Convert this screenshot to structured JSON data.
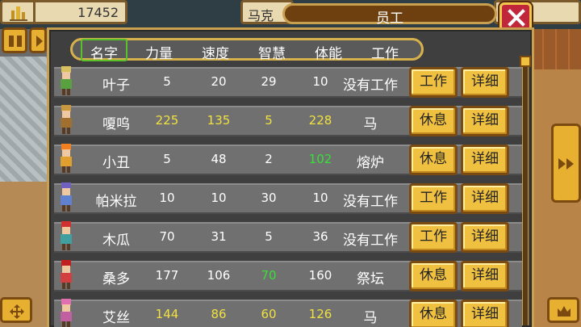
{
  "top": {
    "gold_value": "17452",
    "player_name": "马克",
    "window_title": "员工"
  },
  "columns": [
    "名字",
    "力量",
    "速度",
    "智慧",
    "体能",
    "工作"
  ],
  "rows": [
    {
      "name": "叶子",
      "str": "5",
      "spd": "20",
      "int": "29",
      "sta": "10",
      "job": "没有工作",
      "action": "工作",
      "detail": "详细",
      "colors": {
        "str": "w",
        "spd": "w",
        "int": "w",
        "sta": "w"
      },
      "sprite": {
        "hair": "#d8c060",
        "body": "#58a040"
      }
    },
    {
      "name": "嗄呜",
      "str": "225",
      "spd": "135",
      "int": "5",
      "sta": "228",
      "job": "马",
      "action": "休息",
      "detail": "详细",
      "colors": {
        "str": "y",
        "spd": "y",
        "int": "y",
        "sta": "y"
      },
      "sprite": {
        "hair": "#c89840",
        "body": "#a07030"
      }
    },
    {
      "name": "小丑",
      "str": "5",
      "spd": "48",
      "int": "2",
      "sta": "102",
      "job": "熔炉",
      "action": "休息",
      "detail": "详细",
      "colors": {
        "str": "w",
        "spd": "w",
        "int": "w",
        "sta": "g"
      },
      "sprite": {
        "hair": "#f08020",
        "body": "#e0a030"
      }
    },
    {
      "name": "帕米拉",
      "str": "10",
      "spd": "10",
      "int": "30",
      "sta": "10",
      "job": "没有工作",
      "action": "工作",
      "detail": "详细",
      "colors": {
        "str": "w",
        "spd": "w",
        "int": "w",
        "sta": "w"
      },
      "sprite": {
        "hair": "#7060c0",
        "body": "#6080d0"
      }
    },
    {
      "name": "木瓜",
      "str": "70",
      "spd": "31",
      "int": "5",
      "sta": "36",
      "job": "没有工作",
      "action": "工作",
      "detail": "详细",
      "colors": {
        "str": "w",
        "spd": "w",
        "int": "w",
        "sta": "w"
      },
      "sprite": {
        "hair": "#d03030",
        "body": "#40a0a0"
      }
    },
    {
      "name": "桑多",
      "str": "177",
      "spd": "106",
      "int": "70",
      "sta": "160",
      "job": "祭坛",
      "action": "休息",
      "detail": "详细",
      "colors": {
        "str": "w",
        "spd": "w",
        "int": "g",
        "sta": "w"
      },
      "sprite": {
        "hair": "#c02020",
        "body": "#d04040"
      }
    },
    {
      "name": "艾丝",
      "str": "144",
      "spd": "86",
      "int": "60",
      "sta": "126",
      "job": "马",
      "action": "休息",
      "detail": "详细",
      "colors": {
        "str": "y",
        "spd": "y",
        "int": "y",
        "sta": "y"
      },
      "sprite": {
        "hair": "#e070b0",
        "body": "#c060a0"
      }
    }
  ],
  "accent_colors": {
    "panel_border": "#c8a050",
    "button": "#f0c040",
    "close": "#c1273a",
    "selected": "#59c22a"
  }
}
